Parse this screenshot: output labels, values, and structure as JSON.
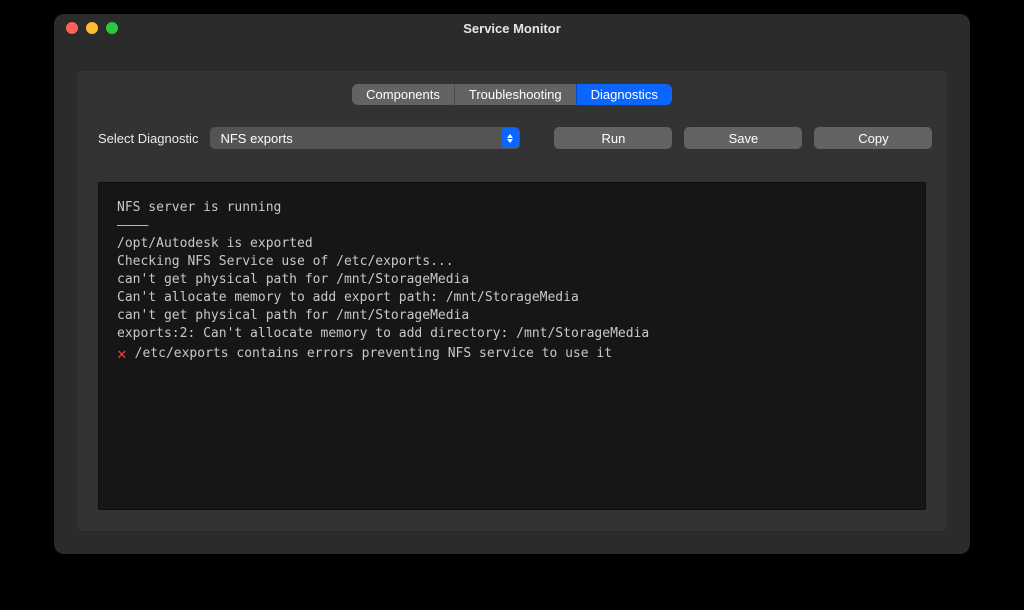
{
  "window": {
    "title": "Service Monitor"
  },
  "tabs": {
    "components": "Components",
    "troubleshooting": "Troubleshooting",
    "diagnostics": "Diagnostics",
    "active": "diagnostics"
  },
  "controls": {
    "select_label": "Select Diagnostic",
    "select_value": "NFS exports",
    "run": "Run",
    "save": "Save",
    "copy": "Copy"
  },
  "console": {
    "lines": [
      "NFS server is running",
      "————",
      "/opt/Autodesk is exported",
      "Checking NFS Service use of /etc/exports...",
      "can't get physical path for /mnt/StorageMedia",
      "Can't allocate memory to add export path: /mnt/StorageMedia",
      "can't get physical path for /mnt/StorageMedia",
      "exports:2: Can't allocate memory to add directory: /mnt/StorageMedia"
    ],
    "error_line": "/etc/exports contains errors preventing NFS service to use it"
  },
  "icons": {
    "error": "✕"
  }
}
